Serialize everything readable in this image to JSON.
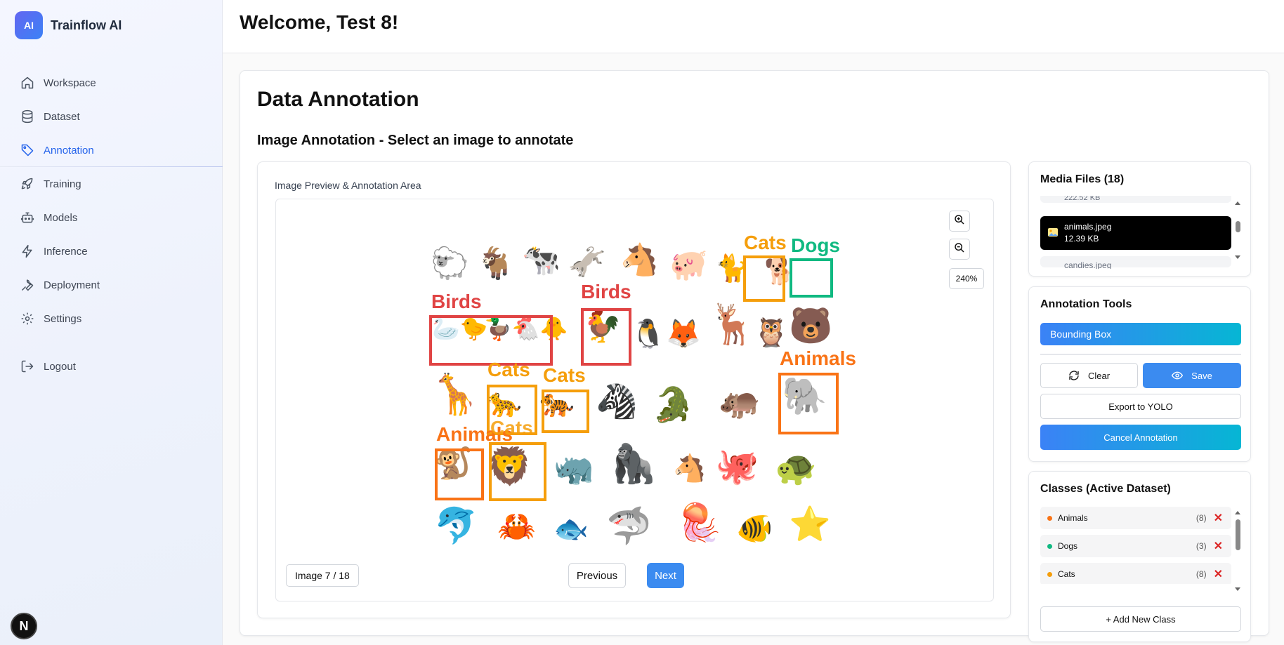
{
  "brand": {
    "logo_text": "AI",
    "name": "Trainflow AI"
  },
  "sidebar": {
    "items": [
      {
        "label": "Workspace",
        "icon": "home-icon",
        "active": false
      },
      {
        "label": "Dataset",
        "icon": "database-icon",
        "active": false
      },
      {
        "label": "Annotation",
        "icon": "tag-icon",
        "active": true
      },
      {
        "label": "Training",
        "icon": "rocket-icon",
        "active": false
      },
      {
        "label": "Models",
        "icon": "bot-icon",
        "active": false
      },
      {
        "label": "Inference",
        "icon": "zap-icon",
        "active": false
      },
      {
        "label": "Deployment",
        "icon": "wrench-icon",
        "active": false
      },
      {
        "label": "Settings",
        "icon": "gear-icon",
        "active": false
      }
    ],
    "logout_label": "Logout",
    "badge_letter": "N"
  },
  "header": {
    "title": "Welcome, Test 8!"
  },
  "main": {
    "title": "Data Annotation",
    "subtitle": "Image Annotation - Select an image to annotate",
    "preview_label": "Image Preview & Annotation Area",
    "zoom_level": "240%",
    "image_counter": "Image 7 / 18",
    "prev_label": "Previous",
    "next_label": "Next",
    "annotations": [
      {
        "label": "Cats",
        "color": "#f59e0b"
      },
      {
        "label": "Dogs",
        "color": "#10b981"
      },
      {
        "label": "Birds",
        "color": "#ef4444"
      },
      {
        "label": "Birds",
        "color": "#ef4444"
      },
      {
        "label": "Animals",
        "color": "#f97316"
      },
      {
        "label": "Cats",
        "color": "#f59e0b"
      },
      {
        "label": "Cats",
        "color": "#f59e0b"
      },
      {
        "label": "Animals",
        "color": "#f97316"
      },
      {
        "label": "Cats",
        "color": "#f59e0b"
      }
    ]
  },
  "media": {
    "title": "Media Files (18)",
    "prev_file_size": "222.52 KB",
    "selected_file": {
      "name": "animals.jpeg",
      "size": "12.39 KB"
    },
    "next_file_name": "candies.jpeg"
  },
  "tools": {
    "title": "Annotation Tools",
    "mode_label": "Bounding Box",
    "clear_label": "Clear",
    "save_label": "Save",
    "export_label": "Export to YOLO",
    "cancel_label": "Cancel Annotation"
  },
  "classes": {
    "title": "Classes (Active Dataset)",
    "items": [
      {
        "name": "Animals",
        "count": "(8)",
        "color": "#f97316"
      },
      {
        "name": "Dogs",
        "count": "(3)",
        "color": "#10b981"
      },
      {
        "name": "Cats",
        "count": "(8)",
        "color": "#f59e0b"
      }
    ],
    "add_label": "+ Add New Class"
  }
}
